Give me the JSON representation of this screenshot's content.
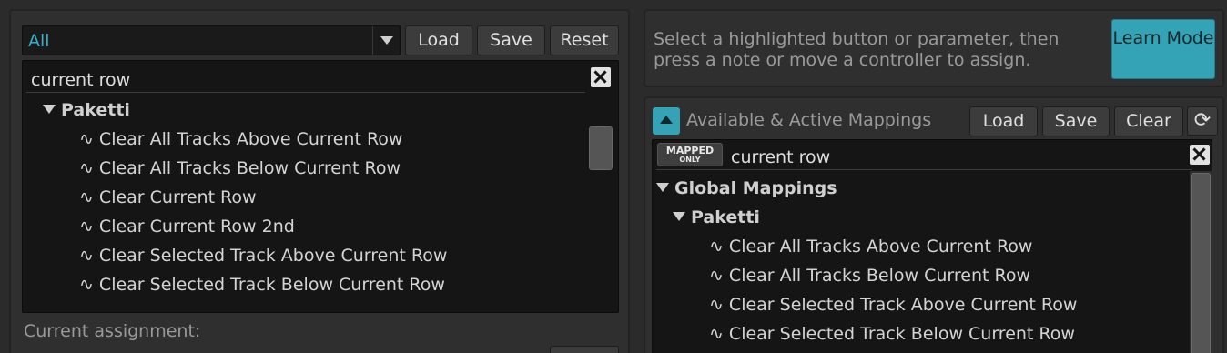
{
  "left": {
    "filter_select": {
      "value": "All"
    },
    "buttons": {
      "load": "Load",
      "save": "Save",
      "reset": "Reset"
    },
    "search": {
      "value": "current row"
    },
    "tree": {
      "group": "Paketti",
      "items": [
        "Clear All Tracks Above Current Row",
        "Clear All Tracks Below Current Row",
        "Clear Current Row",
        "Clear Current Row 2nd",
        "Clear Selected Track Above Current Row",
        "Clear Selected Track Below Current Row"
      ]
    },
    "current_assignment_label": "Current assignment:"
  },
  "right": {
    "hint": "Select a highlighted button or parameter, then press a note or move a controller to assign.",
    "learn_mode_button": "Learn Mode",
    "section_title": "Available & Active Mappings",
    "buttons": {
      "load": "Load",
      "save": "Save",
      "clear": "Clear",
      "refresh_icon": "refresh-icon"
    },
    "mapped_only_badge": {
      "line1": "MAPPED",
      "line2": "ONLY"
    },
    "search": {
      "value": "current row"
    },
    "tree": {
      "root": "Global Mappings",
      "group": "Paketti",
      "items": [
        "Clear All Tracks Above Current Row",
        "Clear All Tracks Below Current Row",
        "Clear Selected Track Above Current Row",
        "Clear Selected Track Below Current Row"
      ]
    }
  },
  "colors": {
    "accent": "#33a3b5",
    "background": "#2b2b2b",
    "list_background": "#151515"
  }
}
